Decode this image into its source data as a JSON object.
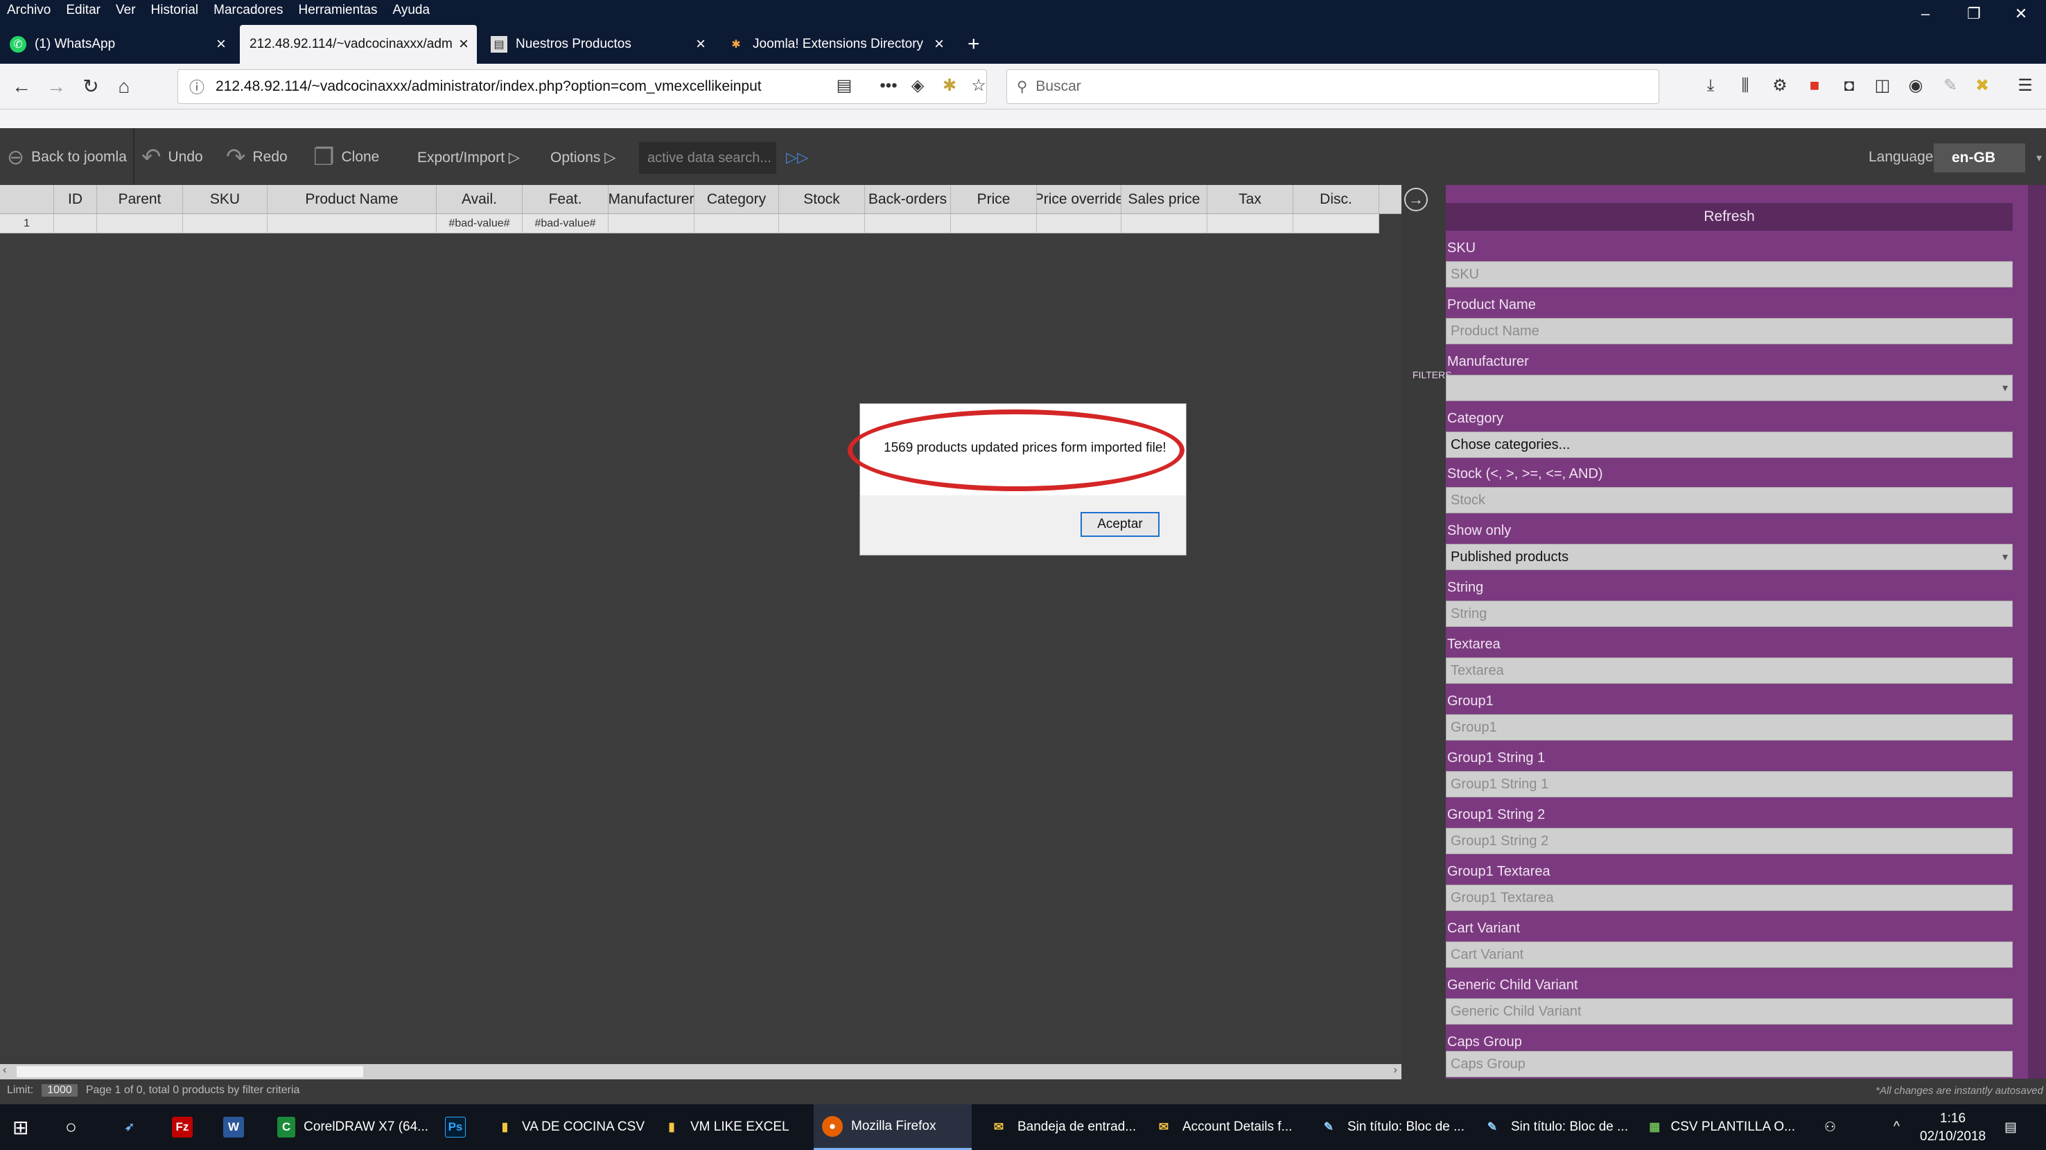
{
  "menu": [
    "Archivo",
    "Editar",
    "Ver",
    "Historial",
    "Marcadores",
    "Herramientas",
    "Ayuda"
  ],
  "tabs": [
    {
      "label": "(1) WhatsApp",
      "icon": "whatsapp-icon"
    },
    {
      "label": "212.48.92.114/~vadcocinaxxx/adm",
      "icon": "none",
      "active": true
    },
    {
      "label": "Nuestros Productos",
      "icon": "page-icon"
    },
    {
      "label": "Joomla! Extensions Directory",
      "icon": "joomla-icon"
    }
  ],
  "urlbar": {
    "url": "212.48.92.114/~vadcocinaxxx/administrator/index.php?option=com_vmexcellikeinput"
  },
  "search": {
    "placeholder": "Buscar"
  },
  "toolbar": {
    "back": "Back to joomla",
    "undo": "Undo",
    "redo": "Redo",
    "clone": "Clone",
    "export": "Export/Import ▷",
    "options": "Options ▷",
    "search_placeholder": "active data search...",
    "language_label": "Language",
    "language_value": "en-GB"
  },
  "grid": {
    "columns": [
      "ID",
      "Parent",
      "SKU",
      "Product Name",
      "Avail.",
      "Feat.",
      "Manufacturer",
      "Category",
      "Stock",
      "Back-orders",
      "Price",
      "Price override",
      "Sales price",
      "Tax",
      "Disc."
    ],
    "row": {
      "num": "1",
      "avail": "#bad-value#",
      "feat": "#bad-value#"
    }
  },
  "dialog": {
    "message": "1569 products updated prices form imported file!",
    "ok": "Aceptar"
  },
  "filters": {
    "vertical_label": "FILTERS",
    "refresh": "Refresh",
    "fields": [
      {
        "label": "SKU",
        "placeholder": "SKU"
      },
      {
        "label": "Product Name",
        "placeholder": "Product Name"
      },
      {
        "label": "Manufacturer",
        "placeholder": ""
      },
      {
        "label": "Category",
        "placeholder": "Chose categories..."
      },
      {
        "label": "Stock (<, >, >=, <=, AND)",
        "placeholder": "Stock"
      },
      {
        "label": "Show only",
        "placeholder": "Published products"
      },
      {
        "label": "String",
        "placeholder": "String"
      },
      {
        "label": "Textarea",
        "placeholder": "Textarea"
      },
      {
        "label": "Group1",
        "placeholder": "Group1"
      },
      {
        "label": "Group1 String 1",
        "placeholder": "Group1 String 1"
      },
      {
        "label": "Group1 String 2",
        "placeholder": "Group1 String 2"
      },
      {
        "label": "Group1 Textarea",
        "placeholder": "Group1 Textarea"
      },
      {
        "label": "Cart Variant",
        "placeholder": "Cart Variant"
      },
      {
        "label": "Generic Child Variant",
        "placeholder": "Generic Child Variant"
      },
      {
        "label": "Caps Group",
        "placeholder": "Caps Group"
      }
    ]
  },
  "status": {
    "limit_label": "Limit:",
    "limit_value": "1000",
    "page_info": "Page 1 of 0, total 0 products by filter criteria",
    "autosave": "*All changes are instantly autosaved"
  },
  "taskbar": {
    "apps": [
      {
        "label": "CorelDRAW X7 (64...",
        "icon": "coreldraw-icon"
      },
      {
        "label": "",
        "icon": "photoshop-icon"
      },
      {
        "label": "VA DE COCINA CSV",
        "icon": "folder-icon"
      },
      {
        "label": "VM LIKE EXCEL",
        "icon": "folder-icon"
      },
      {
        "label": "Mozilla Firefox",
        "icon": "firefox-icon",
        "active": true
      },
      {
        "label": "Bandeja de entrad...",
        "icon": "mail-icon"
      },
      {
        "label": "Account Details f...",
        "icon": "mail-icon"
      },
      {
        "label": "Sin título: Bloc de ...",
        "icon": "notepad-icon"
      },
      {
        "label": "Sin título: Bloc de ...",
        "icon": "notepad-icon"
      },
      {
        "label": "CSV PLANTILLA O...",
        "icon": "file-icon"
      }
    ],
    "time": "1:16",
    "date": "02/10/2018"
  },
  "colors": {
    "accent_purple": "#7b3a7f",
    "highlight_ring": "#d42626"
  }
}
